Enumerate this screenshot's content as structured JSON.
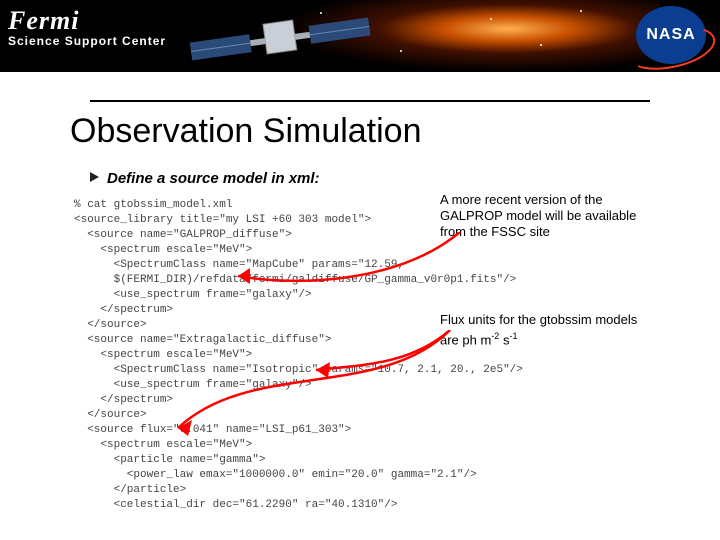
{
  "banner": {
    "brand_title": "Fermi",
    "brand_subtitle": "Science Support Center",
    "nasa_label": "NASA"
  },
  "title": "Observation Simulation",
  "subhead": "Define a source model in xml:",
  "code": {
    "l01": "% cat gtobssim_model.xml",
    "l02": "<source_library title=\"my LSI +60 303 model\">",
    "l03": "  <source name=\"GALPROP_diffuse\">",
    "l04": "    <spectrum escale=\"MeV\">",
    "l05": "      <SpectrumClass name=\"MapCube\" params=\"12.59,",
    "l06": "      $(FERMI_DIR)/refdata/fermi/galdiffuse/GP_gamma_v0r0p1.fits\"/>",
    "l07": "      <use_spectrum frame=\"galaxy\"/>",
    "l08": "    </spectrum>",
    "l09": "  </source>",
    "l10": "  <source name=\"Extragalactic_diffuse\">",
    "l11": "    <spectrum escale=\"MeV\">",
    "l12": "      <SpectrumClass name=\"Isotropic\" params=\"10.7, 2.1, 20., 2e5\"/>",
    "l13": "      <use_spectrum frame=\"galaxy\"/>",
    "l14": "    </spectrum>",
    "l15": "  </source>",
    "l16": "  <source flux=\"0.041\" name=\"LSI_p61_303\">",
    "l17": "    <spectrum escale=\"MeV\">",
    "l18": "      <particle name=\"gamma\">",
    "l19": "        <power_law emax=\"1000000.0\" emin=\"20.0\" gamma=\"2.1\"/>",
    "l20": "      </particle>",
    "l21": "      <celestial_dir dec=\"61.2290\" ra=\"40.1310\"/>"
  },
  "notes": {
    "recent_version": "A more recent version of the GALPROP model will be available from the FSSC site",
    "flux_units_pre": "Flux units for the gtobssim models are ph m",
    "flux_units_exp1": "-2",
    "flux_units_mid": " s",
    "flux_units_exp2": "-1"
  }
}
